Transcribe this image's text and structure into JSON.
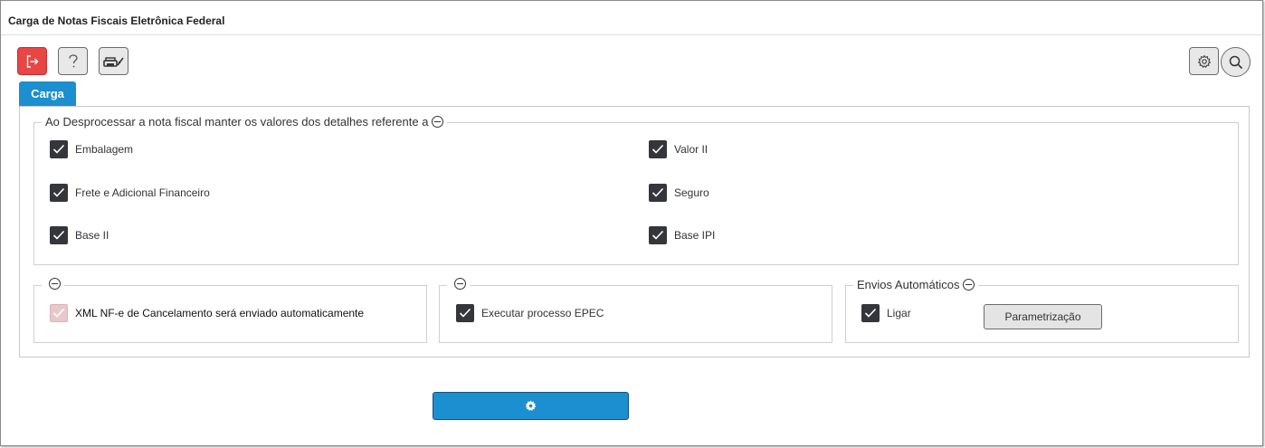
{
  "window": {
    "title": "Carga de Notas Fiscais Eletrônica Federal"
  },
  "toolbar": {
    "exit_icon": "exit-icon",
    "help_icon": "question-icon",
    "printer_icon": "printer-icon",
    "settings_icon": "gear-icon",
    "search_icon": "search-icon",
    "exit_color": "#e84545"
  },
  "tabs": [
    {
      "label": "Carga",
      "active": true
    }
  ],
  "desprocessar": {
    "legend": "Ao Desprocessar a nota fiscal manter os valores dos detalhes referente a",
    "items": [
      {
        "label": "Embalagem",
        "checked": true
      },
      {
        "label": "Valor II",
        "checked": true
      },
      {
        "label": "Frete e Adicional Financeiro",
        "checked": true
      },
      {
        "label": "Seguro",
        "checked": true
      },
      {
        "label": "Base II",
        "checked": true
      },
      {
        "label": "Base IPI",
        "checked": true
      }
    ]
  },
  "cancelamento": {
    "legend": "",
    "label": "XML NF-e de Cancelamento será enviado automaticamente",
    "checked": true,
    "disabled": true
  },
  "epec": {
    "legend": "",
    "label": "Executar processo EPEC",
    "checked": true
  },
  "envios": {
    "legend": "Envios Automáticos",
    "label": "Ligar",
    "checked": true,
    "button_label": "Parametrização"
  },
  "footer": {
    "process_icon": "gear-icon",
    "accent": "#1b8fd0"
  }
}
